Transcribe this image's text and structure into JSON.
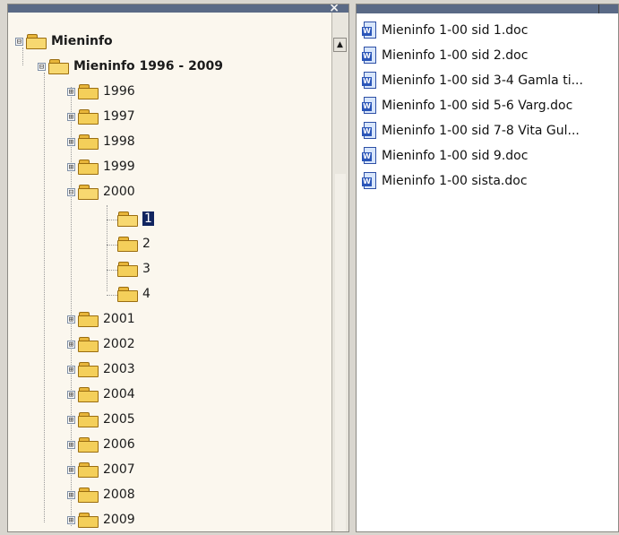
{
  "tree": {
    "root": {
      "label": "Mieninfo",
      "expander": "⊟"
    },
    "child": {
      "label": "Mieninfo 1996 - 2009",
      "expander": "⊟"
    },
    "years": [
      {
        "label": "1996",
        "expander": "⊞"
      },
      {
        "label": "1997",
        "expander": "⊞"
      },
      {
        "label": "1998",
        "expander": "⊞"
      },
      {
        "label": "1999",
        "expander": "⊞"
      },
      {
        "label": "2000",
        "expander": "⊟"
      }
    ],
    "subfolders": [
      {
        "label": "1",
        "selected": true
      },
      {
        "label": "2"
      },
      {
        "label": "3"
      },
      {
        "label": "4"
      }
    ],
    "years_after": [
      {
        "label": "2001",
        "expander": "⊞"
      },
      {
        "label": "2002",
        "expander": "⊞"
      },
      {
        "label": "2003",
        "expander": "⊞"
      },
      {
        "label": "2004",
        "expander": "⊞"
      },
      {
        "label": "2005",
        "expander": "⊞"
      },
      {
        "label": "2006",
        "expander": "⊞"
      },
      {
        "label": "2007",
        "expander": "⊞"
      },
      {
        "label": "2008",
        "expander": "⊞"
      },
      {
        "label": "2009",
        "expander": "⊞"
      }
    ],
    "close_glyph": "×",
    "scroll_up_glyph": "▲"
  },
  "files": [
    {
      "name": "Mieninfo 1-00 sid 1.doc",
      "icon": "word-doc-icon"
    },
    {
      "name": "Mieninfo 1-00 sid 2.doc",
      "icon": "word-doc-icon"
    },
    {
      "name": "Mieninfo 1-00 sid 3-4 Gamla ti...",
      "icon": "word-doc-icon"
    },
    {
      "name": "Mieninfo 1-00 sid 5-6 Varg.doc",
      "icon": "word-doc-icon"
    },
    {
      "name": "Mieninfo 1-00 sid 7-8 Vita Gul...",
      "icon": "word-doc-icon"
    },
    {
      "name": "Mieninfo 1-00 sid 9.doc",
      "icon": "word-doc-icon"
    },
    {
      "name": "Mieninfo 1-00 sista.doc",
      "icon": "word-doc-icon"
    }
  ],
  "doc_icon_letter": "W"
}
